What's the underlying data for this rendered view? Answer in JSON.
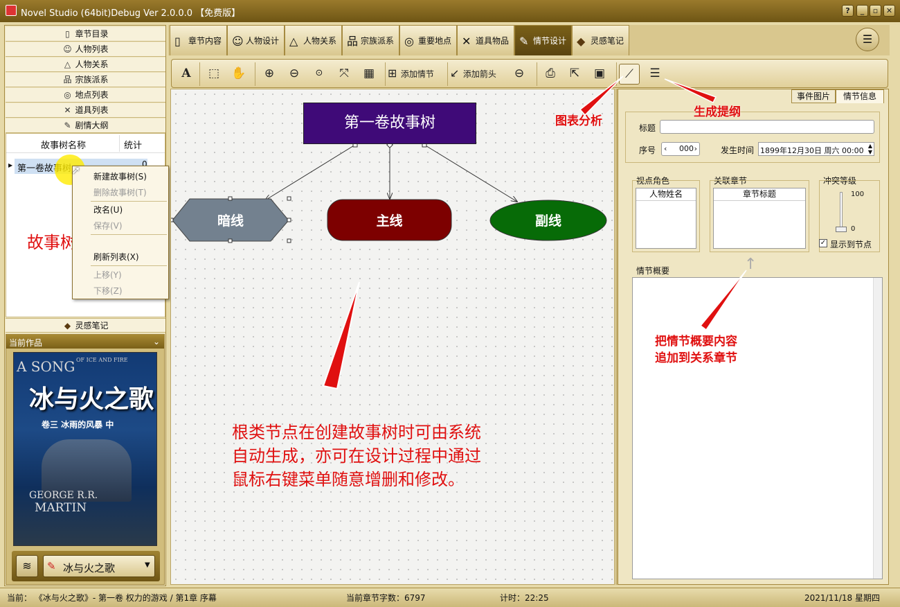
{
  "window": {
    "title": "Novel Studio (64bit)Debug Ver 2.0.0.0 【免费版】",
    "controls": [
      "?",
      "_",
      "▫",
      "✕"
    ]
  },
  "left_nav": {
    "items": [
      {
        "label": "章节目录",
        "icon": "chapter-icon"
      },
      {
        "label": "人物列表",
        "icon": "person-icon"
      },
      {
        "label": "人物关系",
        "icon": "relation-icon"
      },
      {
        "label": "宗族派系",
        "icon": "clan-icon"
      },
      {
        "label": "地点列表",
        "icon": "location-icon"
      },
      {
        "label": "道具列表",
        "icon": "props-icon"
      },
      {
        "label": "剧情大纲",
        "icon": "outline-icon"
      }
    ],
    "bottom_item": "灵感笔记"
  },
  "tree": {
    "col_name": "故事树名称",
    "col_count": "统计",
    "rows": [
      {
        "name": "第一卷故事树",
        "count": "0"
      }
    ]
  },
  "context_menu": [
    {
      "label": "新建故事树(S)",
      "enabled": true
    },
    {
      "label": "删除故事树(T)",
      "enabled": false
    },
    {
      "label": "改名(U)",
      "enabled": true
    },
    {
      "label": "保存(V)",
      "enabled": false
    },
    {
      "label": "刷新列表(X)",
      "enabled": true
    },
    {
      "label": "上移(Y)",
      "enabled": false
    },
    {
      "label": "下移(Z)",
      "enabled": false
    }
  ],
  "current_work": {
    "header": "当前作品",
    "book_title": "冰与火之歌",
    "cover": {
      "en_title_1": "A SONG",
      "en_title_2": "OF ICE AND FIRE",
      "cn_title": "冰与火之歌",
      "subtitle": "卷三 冰雨的风暴 中",
      "author_1": "GEORGE R.R.",
      "author_2": "MARTIN"
    }
  },
  "tabs": [
    {
      "label": "章节内容",
      "icon": "document-icon"
    },
    {
      "label": "人物设计",
      "icon": "person-icon"
    },
    {
      "label": "人物关系",
      "icon": "relation-icon"
    },
    {
      "label": "宗族派系",
      "icon": "clan-icon"
    },
    {
      "label": "重要地点",
      "icon": "location-icon"
    },
    {
      "label": "道具物品",
      "icon": "props-icon"
    },
    {
      "label": "情节设计",
      "icon": "edit-icon",
      "active": true
    },
    {
      "label": "灵感笔记",
      "icon": "diamond-icon"
    }
  ],
  "toolbar": {
    "add_plot": "添加情节",
    "add_arrow": "添加箭头"
  },
  "diagram": {
    "root": "第一卷故事树",
    "node_dark": "暗线",
    "node_main": "主线",
    "node_side": "副线"
  },
  "right_panel": {
    "tab_event_image": "事件图片",
    "tab_plot_info": "情节信息",
    "title_label": "标题",
    "title_value": "",
    "seq_label": "序号",
    "seq_value": "000",
    "time_label": "发生时间",
    "time_value": "1899年12月30日 周六 00:00",
    "pov_label": "视点角色",
    "pov_col": "人物姓名",
    "chapter_label": "关联章节",
    "chapter_col": "章节标题",
    "conflict_label": "冲突等级",
    "conflict_max": "100",
    "conflict_min": "0",
    "conflict_value": 0,
    "show_node": "显示到节点",
    "summary_label": "情节概要"
  },
  "annotations": {
    "chart_analysis": "图表分析",
    "gen_outline": "生成提纲",
    "append_line1": "把情节概要内容",
    "append_line2": "追加到关系章节",
    "tree_list": "故事树列表",
    "note_line1": "根类节点在创建故事树时可由系统",
    "note_line2": "自动生成，亦可在设计过程中通过",
    "note_line3": "鼠标右键菜单随意增删和修改。"
  },
  "status": {
    "current": "当前： 《冰与火之歌》- 第一卷 权力的游戏 / 第1章 序幕",
    "word_count": "当前章节字数：6797",
    "timer": "计时：22:25",
    "date": "2021/11/18 星期四"
  },
  "colors": {
    "root": "#3f0a78",
    "main": "#7d0000",
    "side": "#076b07",
    "dark": "#73818f",
    "accent": "#7a6018",
    "annotation": "#e01010"
  }
}
